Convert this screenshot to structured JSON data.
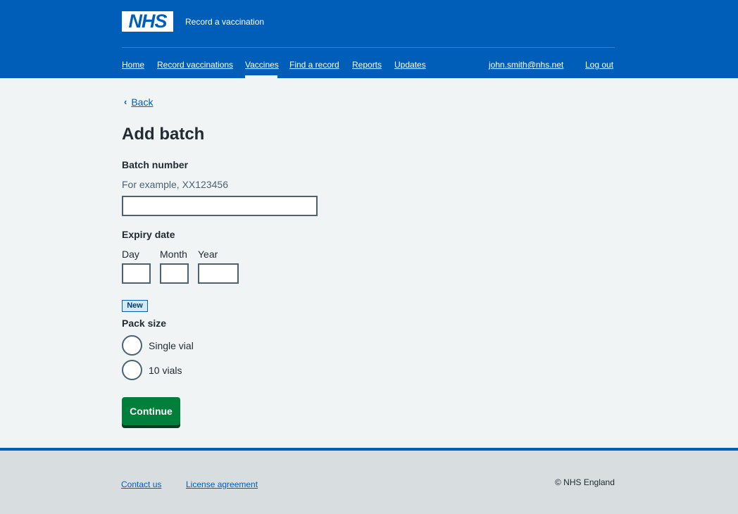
{
  "header": {
    "logo_text": "NHS",
    "service_name": "Record a vaccination",
    "nav": [
      {
        "label": "Home"
      },
      {
        "label": "Record vaccinations"
      },
      {
        "label": "Vaccines",
        "active": true
      },
      {
        "label": "Find a record"
      },
      {
        "label": "Reports"
      },
      {
        "label": "Updates"
      }
    ],
    "account_email": "john.smith@nhs.net",
    "logout_label": "Log out"
  },
  "back_link": {
    "label": "Back"
  },
  "page_title": "Add batch",
  "form": {
    "batch_number": {
      "label": "Batch number",
      "hint": "For example, XX123456",
      "value": ""
    },
    "expiry_date": {
      "label": "Expiry date",
      "day_label": "Day",
      "month_label": "Month",
      "year_label": "Year",
      "day_value": "",
      "month_value": "",
      "year_value": ""
    },
    "new_tag": "New",
    "pack_size": {
      "label": "Pack size",
      "options": [
        {
          "label": "Single vial",
          "selected": false
        },
        {
          "label": "10 vials",
          "selected": false
        }
      ]
    },
    "continue_label": "Continue"
  },
  "footer": {
    "links": [
      {
        "label": "Contact us"
      },
      {
        "label": "License agreement"
      }
    ],
    "copyright": "© NHS England"
  },
  "colors": {
    "brand_blue": "#005eb8",
    "page_background": "#f0f4f5",
    "button_green": "#007f3b",
    "footer_background": "#d8dde0"
  }
}
